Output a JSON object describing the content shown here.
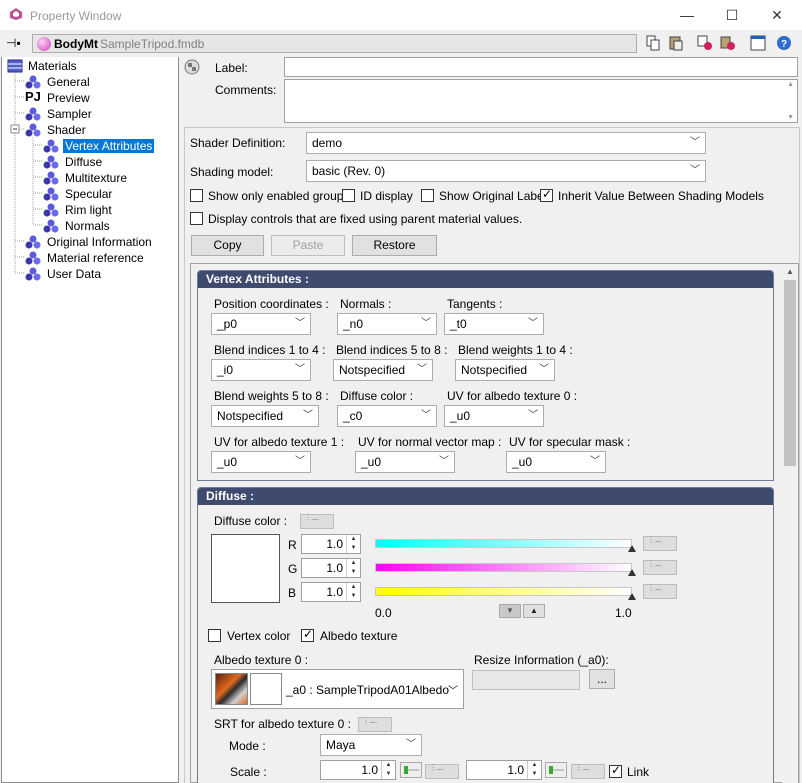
{
  "window": {
    "title": "Property Window"
  },
  "address": {
    "name": "BodyMt",
    "file": "SampleTripod.fmdb"
  },
  "tree": {
    "items": [
      {
        "label": "Materials"
      },
      {
        "label": "General"
      },
      {
        "label": "Preview"
      },
      {
        "label": "Sampler"
      },
      {
        "label": "Shader"
      },
      {
        "label": "Vertex Attributes"
      },
      {
        "label": "Diffuse"
      },
      {
        "label": "Multitexture"
      },
      {
        "label": "Specular"
      },
      {
        "label": "Rim light"
      },
      {
        "label": "Normals"
      },
      {
        "label": "Original Information"
      },
      {
        "label": "Material reference"
      },
      {
        "label": "User Data"
      }
    ],
    "selected": "Vertex Attributes"
  },
  "top": {
    "label_label": "Label:",
    "comments_label": "Comments:",
    "label_value": "",
    "comments_value": ""
  },
  "shader": {
    "definition_label": "Shader Definition:",
    "definition_value": "demo",
    "model_label": "Shading model:",
    "model_value": "basic (Rev. 0)",
    "opt_enabled_groups": "Show only enabled groups",
    "opt_id_display": "ID display",
    "opt_original_label": "Show Original Label",
    "opt_inherit": "Inherit Value Between Shading Models",
    "opt_fixed_controls": "Display controls that are fixed using parent material values.",
    "copy": "Copy",
    "paste": "Paste",
    "restore": "Restore"
  },
  "vertex": {
    "title": "Vertex Attributes :",
    "fields": [
      {
        "label": "Position coordinates :",
        "value": "_p0"
      },
      {
        "label": "Normals :",
        "value": "_n0"
      },
      {
        "label": "Tangents :",
        "value": "_t0"
      },
      {
        "label": "Blend indices 1 to 4 :",
        "value": "_i0"
      },
      {
        "label": "Blend indices 5 to 8 :",
        "value": "Notspecified"
      },
      {
        "label": "Blend weights 1 to 4 :",
        "value": "Notspecified"
      },
      {
        "label": "Blend weights 5 to 8 :",
        "value": "Notspecified"
      },
      {
        "label": "Diffuse color :",
        "value": "_c0"
      },
      {
        "label": "UV for albedo texture 0 :",
        "value": "_u0"
      },
      {
        "label": "UV for albedo texture 1 :",
        "value": "_u0"
      },
      {
        "label": "UV for normal vector map :",
        "value": "_u0"
      },
      {
        "label": "UV for specular mask :",
        "value": "_u0"
      }
    ]
  },
  "diffuse": {
    "title": "Diffuse :",
    "color_label": "Diffuse color :",
    "r_label": "R",
    "g_label": "G",
    "b_label": "B",
    "r": "1.0",
    "g": "1.0",
    "b": "1.0",
    "scale_min": "0.0",
    "scale_max": "1.0",
    "vertex_color": "Vertex color",
    "albedo_texture": "Albedo texture",
    "albedo0_label": "Albedo texture 0 :",
    "albedo0_value": "_a0 : SampleTripodA01Albedo",
    "resize_label": "Resize Information (_a0):",
    "resize_btn": "...",
    "srt_label": "SRT for albedo texture 0 :",
    "mode_label": "Mode :",
    "mode_value": "Maya",
    "scale_label": "Scale :",
    "scale_x": "1.0",
    "scale_y": "1.0",
    "link_label": "Link"
  },
  "colors": {
    "section_header": "#3f4b6e",
    "selection": "#0078d7"
  }
}
